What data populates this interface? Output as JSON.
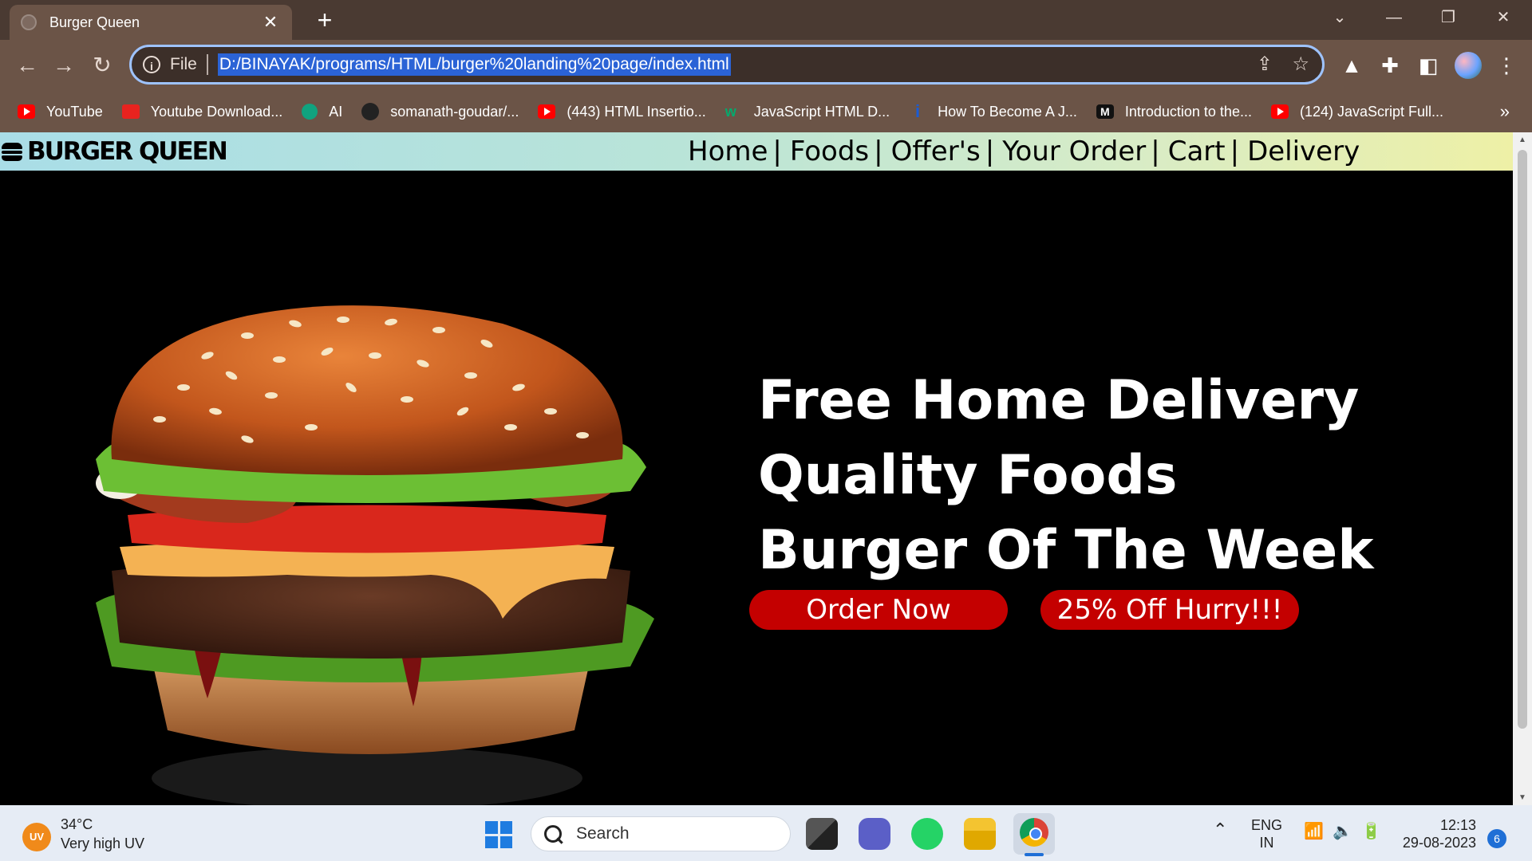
{
  "browser": {
    "tab_title": "Burger Queen",
    "tab_close": "✕",
    "new_tab": "+",
    "omnibox": {
      "scheme": "File",
      "url": "D:/BINAYAK/programs/HTML/burger%20landing%20page/index.html"
    },
    "bookmarks": [
      {
        "label": "YouTube",
        "icon": "youtube-icon"
      },
      {
        "label": "Youtube Download...",
        "icon": "download-icon"
      },
      {
        "label": "AI",
        "icon": "openai-icon"
      },
      {
        "label": "somanath-goudar/...",
        "icon": "github-icon"
      },
      {
        "label": "(443) HTML Insertio...",
        "icon": "youtube-icon"
      },
      {
        "label": "JavaScript HTML D...",
        "icon": "w3schools-icon"
      },
      {
        "label": "How To Become A J...",
        "icon": "info-icon"
      },
      {
        "label": "Introduction to the...",
        "icon": "medium-icon"
      },
      {
        "label": "(124) JavaScript Full...",
        "icon": "youtube-icon"
      }
    ],
    "bookmarks_more": "»"
  },
  "site": {
    "logo": "BURGER QUEEN",
    "nav": [
      "Home",
      "Foods",
      "Offer's",
      "Your Order",
      "Cart",
      "Delivery"
    ],
    "nav_separator": "|",
    "hero_lines": [
      "Free Home Delivery",
      "Quality Foods",
      "Burger Of The Week"
    ],
    "cta_order": "Order Now",
    "cta_offer": "25% Off Hurry!!!",
    "accent_color": "#c40000"
  },
  "taskbar": {
    "weather_badge": "UV",
    "temperature": "34°C",
    "weather_desc": "Very high UV",
    "search_placeholder": "Search",
    "language": "ENG",
    "region": "IN",
    "time": "12:13",
    "date": "29-08-2023",
    "notifications": "6"
  }
}
